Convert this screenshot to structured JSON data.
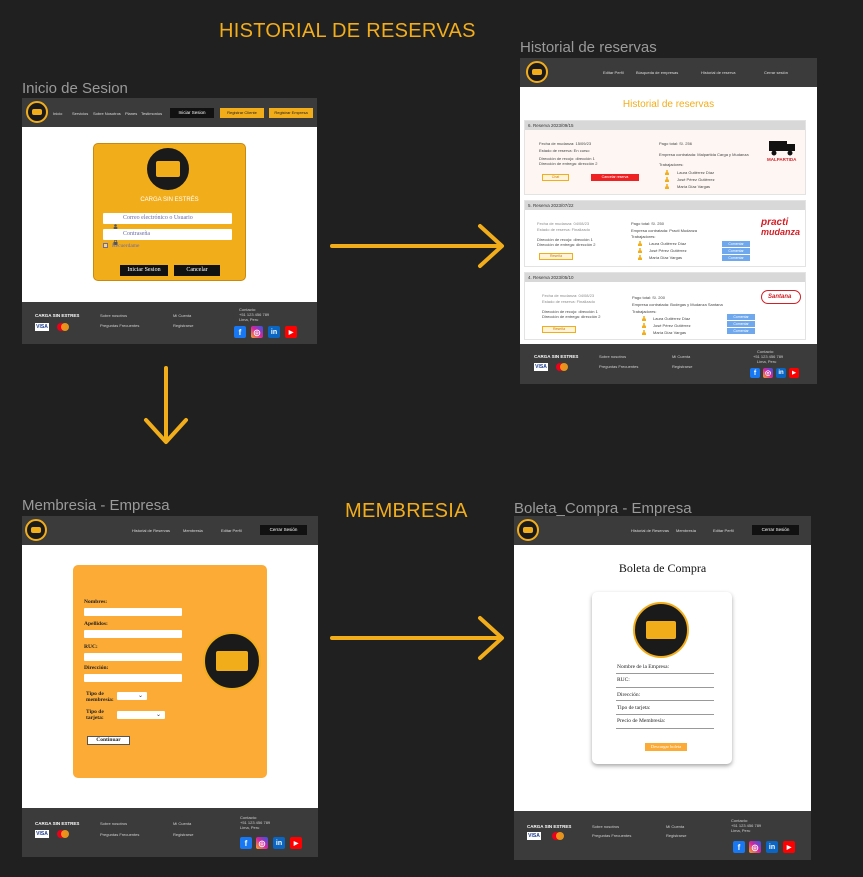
{
  "sections": {
    "historial": "HISTORIAL DE RESERVAS",
    "membresia": "MEMBRESIA"
  },
  "frames": {
    "login": "Inicio de Sesion",
    "historial": "Historial de reservas",
    "membresia": "Membresia - Empresa",
    "boleta": "Boleta_Compra - Empresa"
  },
  "login": {
    "nav": [
      "Inicio",
      "Servicios",
      "Sobre Nosotros",
      "Planes",
      "Testimonios"
    ],
    "btn_iniciar_nav": "Iniciar Sesion",
    "btn_registrar_cliente": "Registrar Cliente",
    "btn_registrar_empresa": "Registrar Empresa",
    "brand": "CARGA SIN ESTRÉS",
    "user_placeholder": "Correo electrónico o Usuario",
    "pass_placeholder": "Contraseña",
    "remember": "Recuerdame",
    "btn_login": "Iniciar Sesion",
    "btn_cancel": "Cancelar"
  },
  "footer": {
    "brand": "CARGA SIN ESTRES",
    "about": "Sobre nosotros",
    "faq": "Preguntas Frecuentes",
    "account": "Mi Cuenta",
    "register": "Registrarse",
    "contact": "Contacto:",
    "phone": "+51 123 456 789",
    "city": "Lima, Peru",
    "visa": "VISA"
  },
  "historial": {
    "nav": [
      "Editar Perfil",
      "Búsqueda de empresas",
      "Historial de reserva",
      "Cerrar sesión"
    ],
    "title": "Historial de reservas",
    "r1": {
      "head": "6. Reserva 2023/09/15",
      "fecha": "Fecha de mudanza: 15/09/23",
      "estado": "Estado de reserva: En curso",
      "recojo": "Dirección de recojo: dirección 1",
      "entrega": "Dirección de entrega: dirección 2",
      "pago": "Pago total:     S/. 256",
      "empresa": "Empresa contratada:     Malpartida Carga y Mudanza",
      "trab": "Trabajadores:",
      "w": [
        "Laura Gutiérrez Díaz",
        "José Pérez Gutiérrez",
        "María Díaz Vargas"
      ],
      "btn1": "Chat",
      "btn2": "Cancelar reserva",
      "logo": "MALPARTIDA"
    },
    "r2": {
      "head": "5. Reserva 2023/07/22",
      "fecha": "Fecha de mudanza: 04/08/23",
      "estado": "Estado de reserva: Finalizado",
      "recojo": "Dirección de recojo: dirección 1",
      "entrega": "Dirección de entrega: dirección 2",
      "pago": "Pago total:     S/. 250",
      "empresa": "Empresa contratada:     Practi Mudanza",
      "trab": "Trabajadores:",
      "w": [
        "Laura Gutiérrez Díaz",
        "José Pérez Gutiérrez",
        "María Díaz Vargas"
      ],
      "cal": "Comentar",
      "btn": "Reseña",
      "logo1": "practi",
      "logo2": "mudanza"
    },
    "r3": {
      "head": "4. Reserva 2023/05/10",
      "fecha": "Fecha de mudanza: 04/08/23",
      "estado": "Estado de reserva: Finalizado",
      "recojo": "Dirección de recojo: dirección 1",
      "entrega": "Dirección de entrega: dirección 2",
      "pago": "Pago total:     S/. 200",
      "empresa": "Empresa contratada:     Bodegas y Mudanza Santana",
      "trab": "Trabajadores:",
      "w": [
        "Laura Gutiérrez Díaz",
        "José Pérez Gutiérrez",
        "María Díaz Vargas"
      ],
      "cal": "Comentar",
      "btn": "Reseña",
      "logo": "Santana"
    }
  },
  "membresia": {
    "nav": [
      "Historial de Reservas",
      "Membresia",
      "Editar Perfil"
    ],
    "btn_logout": "Cerrar Sesión",
    "nombres": "Nombres:",
    "apellidos": "Apellidos:",
    "ruc": "RUC:",
    "direccion": "Dirección:",
    "tipo_membresia": "Tipo de membresía:",
    "tipo_tarjeta": "Tipo de tarjeta:",
    "btn_continuar": "Continuar"
  },
  "boleta": {
    "nav": [
      "Historial de Reservas",
      "Membresía",
      "Editar Perfil"
    ],
    "btn_logout": "Cerrar Sesión",
    "title": "Boleta de Compra",
    "nombre_empresa": "Nombre de la Empresa:",
    "ruc": "RUC:",
    "direccion": "Dirección:",
    "tipo_tarjeta": "Tipo de tarjeta:",
    "precio": "Precio de Membresía:",
    "btn_descargar": "Descargar boleta"
  }
}
